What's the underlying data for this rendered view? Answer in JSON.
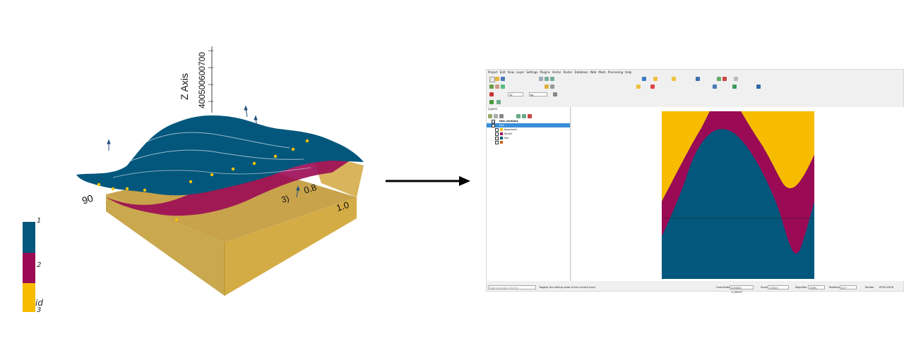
{
  "scene3d": {
    "axis_title": "Z Axis",
    "z_ticks": "400500600700",
    "tick_90": "90",
    "tick_08": "0.8",
    "tick_10": "1.0",
    "tick_3": "3)"
  },
  "legend": {
    "labels": [
      "1",
      "2",
      "id",
      "3"
    ],
    "colors": {
      "unit1": "#03577c",
      "unit2": "#9b0a55",
      "unit3": "#f7bc00"
    }
  },
  "qgis": {
    "menu": [
      "Project",
      "Edit",
      "View",
      "Layer",
      "Settings",
      "Plugins",
      "Vector",
      "Raster",
      "Database",
      "Web",
      "Mesh",
      "Processing",
      "Help"
    ],
    "layers_title": "Layers",
    "layers": [
      {
        "label": "test_sections"
      },
      {
        "label": "test",
        "selected": true
      },
      {
        "label": "basement",
        "color": "#f7bc00"
      },
      {
        "label": "Sand1",
        "color": "#9b0a55"
      },
      {
        "label": "Sec",
        "color": "#03577c"
      },
      {
        "label": "",
        "color": "#c6641a"
      }
    ],
    "locate_placeholder": "Type to locate (Ctrl+K)",
    "status_message": "Toggles the editing state of the current layer",
    "coordinate_label": "Coordinate",
    "coordinate_value": "4,53422 -0,00007",
    "scale_label": "Scale",
    "scale_value": "1:3211",
    "magnifier_label": "Magnifier",
    "magnifier_value": "100%",
    "rotation_label": "Rotation",
    "rotation_value": "0,0 °",
    "render_label": "Render",
    "crs_label": "EPSG:4326",
    "font_size_value": "12",
    "font_unit": "px"
  }
}
